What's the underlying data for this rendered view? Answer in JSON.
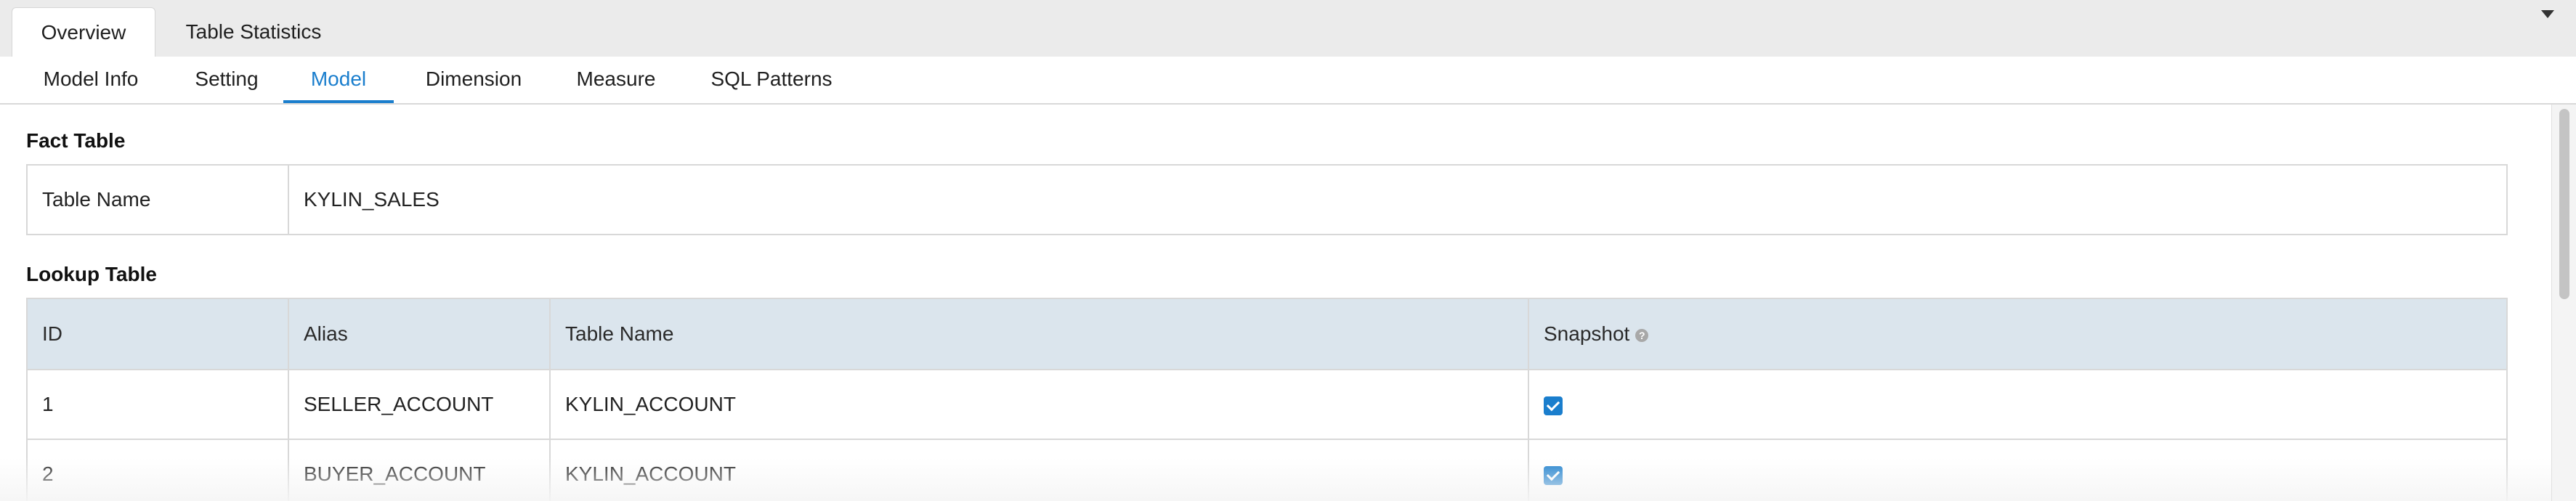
{
  "top_tabs": [
    {
      "label": "Overview",
      "active": true
    },
    {
      "label": "Table Statistics",
      "active": false
    }
  ],
  "sub_tabs": [
    {
      "label": "Model Info"
    },
    {
      "label": "Setting"
    },
    {
      "label": "Model",
      "active": true
    },
    {
      "label": "Dimension"
    },
    {
      "label": "Measure"
    },
    {
      "label": "SQL Patterns"
    }
  ],
  "fact_table": {
    "title": "Fact Table",
    "label": "Table Name",
    "value": "KYLIN_SALES"
  },
  "lookup_table": {
    "title": "Lookup Table",
    "headers": [
      "ID",
      "Alias",
      "Table Name",
      "Snapshot"
    ],
    "help_icon": "question-circle-icon",
    "rows": [
      {
        "id": "1",
        "alias": "SELLER_ACCOUNT",
        "table_name": "KYLIN_ACCOUNT",
        "snapshot": true
      },
      {
        "id": "2",
        "alias": "BUYER_ACCOUNT",
        "table_name": "KYLIN_ACCOUNT",
        "snapshot": true
      }
    ]
  },
  "colors": {
    "accent": "#1a7ecd",
    "header_bg": "#dbe5ed",
    "tab_bar_bg": "#ebebeb"
  }
}
